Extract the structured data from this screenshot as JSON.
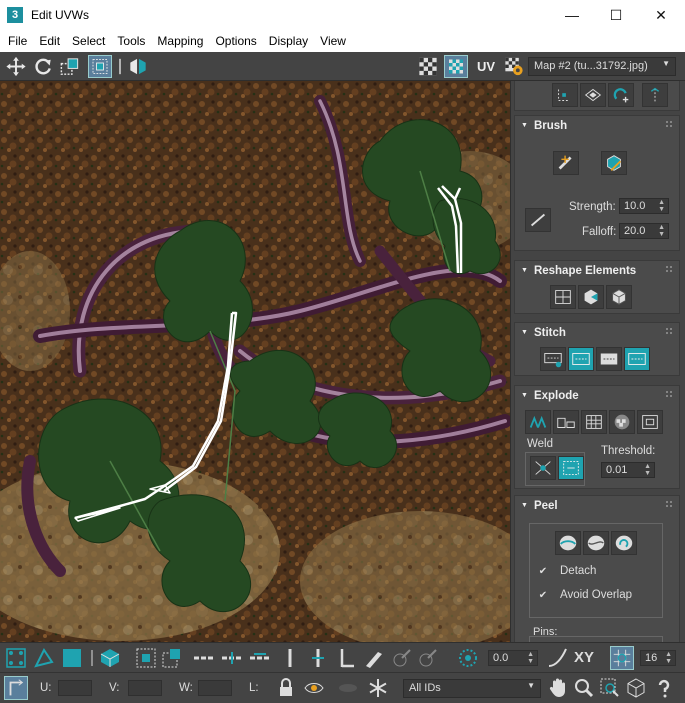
{
  "window": {
    "title": "Edit UVWs",
    "app_badge": "3",
    "controls": {
      "minimize": "—",
      "maximize": "☐",
      "close": "✕"
    }
  },
  "menu": [
    "File",
    "Edit",
    "Select",
    "Tools",
    "Mapping",
    "Options",
    "Display",
    "View"
  ],
  "toolbar": {
    "uv_label": "UV",
    "map_dropdown": "Map #2 (tu...31792.jpg)"
  },
  "brush": {
    "header": "Brush",
    "strength_label": "Strength:",
    "strength_value": "10.0",
    "falloff_label": "Falloff:",
    "falloff_value": "20.0"
  },
  "reshape": {
    "header": "Reshape Elements"
  },
  "stitch": {
    "header": "Stitch"
  },
  "explode": {
    "header": "Explode",
    "weld_label": "Weld",
    "threshold_label": "Threshold:",
    "threshold_value": "0.01"
  },
  "peel": {
    "header": "Peel",
    "detach_label": "Detach",
    "detach_checked": "✔",
    "avoid_overlap_label": "Avoid Overlap",
    "avoid_overlap_checked": "✔",
    "pins_label": "Pins:"
  },
  "bottom": {
    "spinner_value": "0.0",
    "xy_label": "XY",
    "grid_value": "16",
    "u_label": "U:",
    "v_label": "V:",
    "w_label": "W:",
    "l_label": "L:",
    "ids_dropdown": "All IDs"
  },
  "colors": {
    "accent": "#1fa3b0",
    "panel": "#444444",
    "uv_lines": "#ffffff"
  }
}
